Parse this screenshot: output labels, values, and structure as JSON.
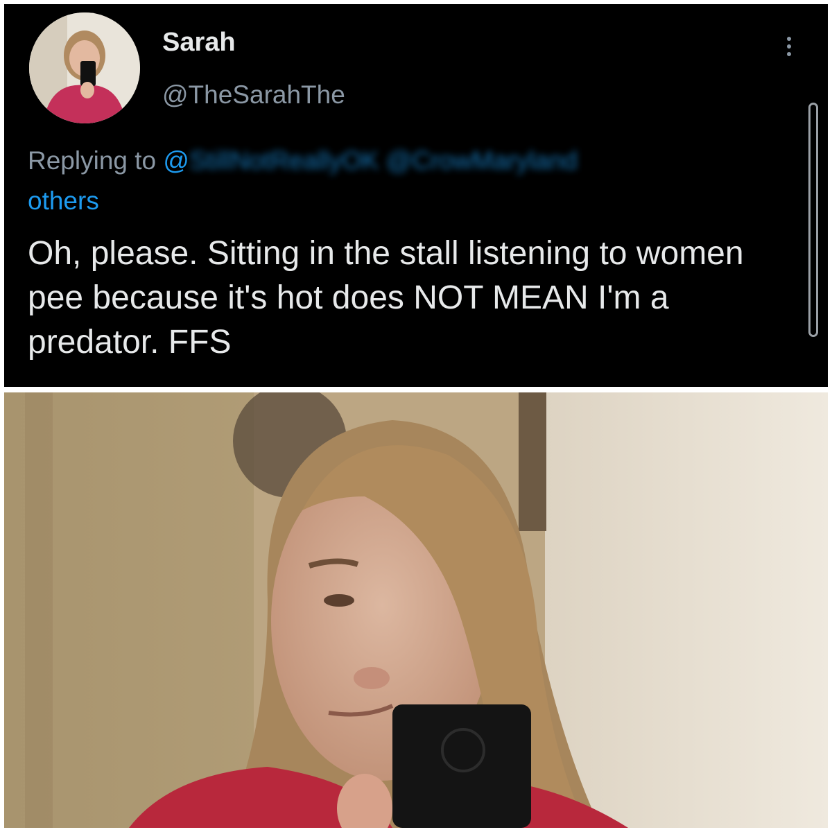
{
  "tweet": {
    "display_name": "Sarah",
    "handle": "@TheSarahThe",
    "replying_prefix": "Replying to ",
    "replying_mention": "@",
    "replying_blurred": "StillNotReallyOK @CrowMaryland",
    "replying_others": "others",
    "text": "Oh, please. Sitting in the stall listening to women pee because it's hot does NOT MEAN I'm a predator. FFS",
    "more_icon": "more-horizontal-icon"
  },
  "colors": {
    "background": "#000000",
    "primary_text": "#e7e9ea",
    "secondary_text": "#8b98a5",
    "link": "#1d9bf0"
  },
  "photo": {
    "description_icon": "mirror-selfie-photo"
  }
}
